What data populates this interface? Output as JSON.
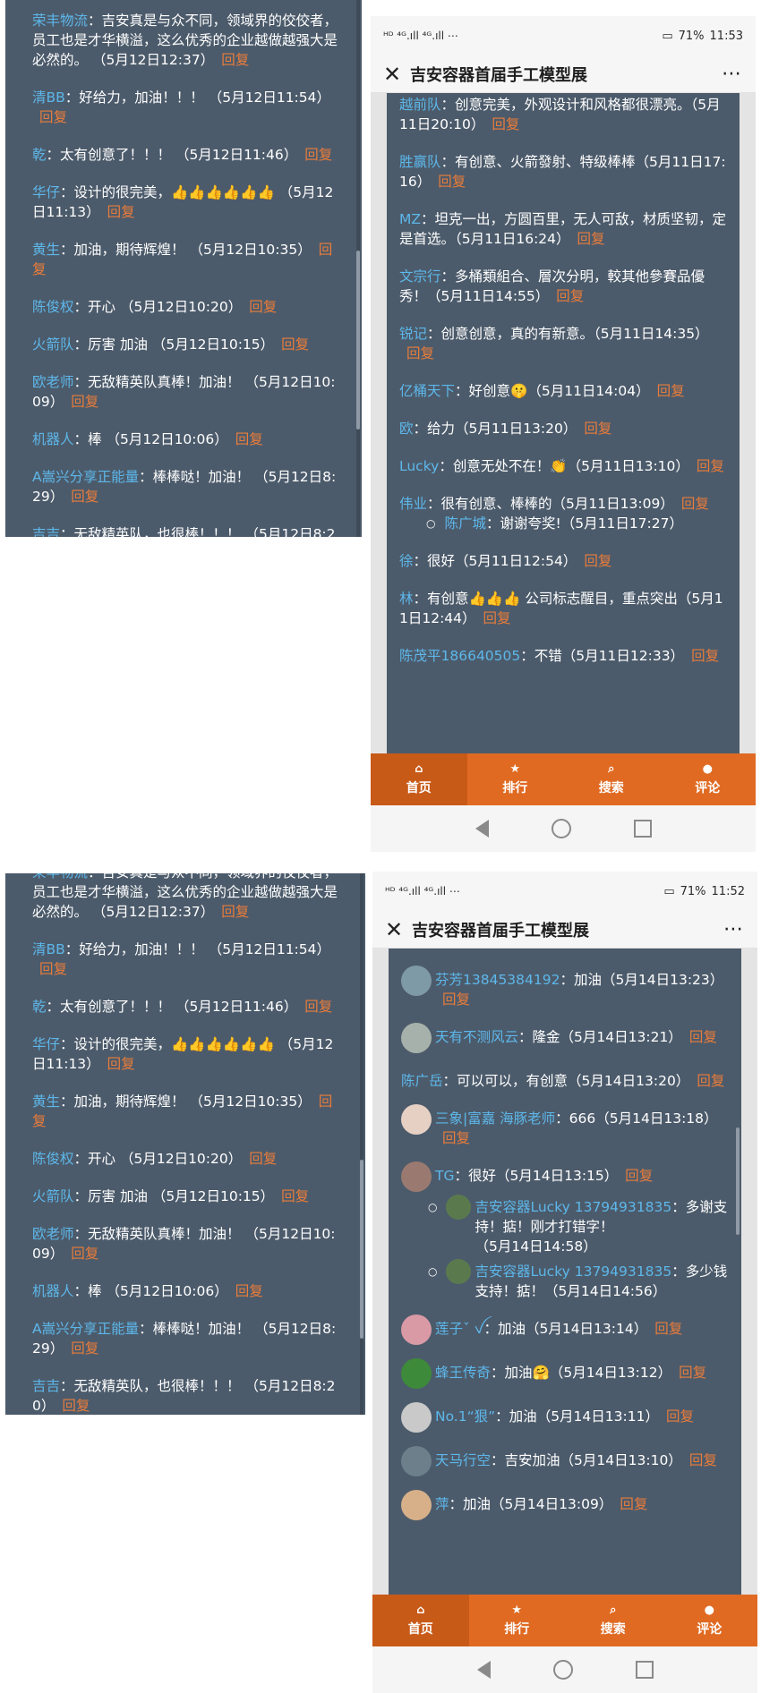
{
  "page": {
    "title": "吉安容器首届手工模型展",
    "reply_label": "回复",
    "colors": {
      "name": "#5db7ea",
      "reply": "#ea7c3a",
      "panel": "#4c5b6b",
      "tabbar": "#e06a22"
    }
  },
  "panel_comments": [
    {
      "name": "荣丰物流",
      "text": "吉安真是与众不同，领域界的佼佼者，员工也是才华横溢，这么优秀的企业越做越强大是必然的。",
      "time": "（5月12日12:37）"
    },
    {
      "name": "清BB",
      "text": "好给力，加油！！！",
      "time": "（5月12日11:54）"
    },
    {
      "name": "乾",
      "text": "太有创意了！！！",
      "time": "（5月12日11:46）"
    },
    {
      "name": "华仔",
      "text": "设计的很完美，👍👍👍👍👍👍",
      "time": "（5月12日11:13）"
    },
    {
      "name": "黄生",
      "text": "加油，期待辉煌！",
      "time": "（5月12日10:35）"
    },
    {
      "name": "陈俊权",
      "text": "开心",
      "time": "（5月12日10:20）"
    },
    {
      "name": "火箭队",
      "text": "厉害 加油",
      "time": "（5月12日10:15）"
    },
    {
      "name": "欧老师",
      "text": "无敌精英队真棒！加油！",
      "time": "（5月12日10:09）"
    },
    {
      "name": "机器人",
      "text": "棒",
      "time": "（5月12日10:06）"
    },
    {
      "name": "A嵩兴分享正能量",
      "text": "棒棒哒！加油！",
      "time": "（5月12日8:29）"
    },
    {
      "name": "吉吉",
      "text": "无敌精英队，也很棒！！！",
      "time": "（5月12日8:20）"
    }
  ],
  "phone1": {
    "status_bar": {
      "indicators": "ᴴᴰ ⁴ᴳ.ıll ⁴ᴳ.ıll ⋯",
      "battery": "71%",
      "time": "11:53"
    },
    "comments": [
      {
        "name": "越前队",
        "text": "创意完美，外观设计和风格都很漂亮。",
        "time": "（5月11日20:10）"
      },
      {
        "name": "胜赢队",
        "text": "有创意、火箭發射、特级棒棒",
        "time": "（5月11日17:16）"
      },
      {
        "name": "MZ",
        "text": "坦克一出，方圆百里，无人可敌，材质坚韧，定是首选。",
        "time": "（5月11日16:24）"
      },
      {
        "name": "文宗行",
        "text": "多桶類組合、層次分明，較其他參賽品優秀！",
        "time": "（5月11日14:55）"
      },
      {
        "name": "锐记",
        "text": "创意创意，真的有新意。",
        "time": "（5月11日14:35）"
      },
      {
        "name": "亿桶天下",
        "text": "好创意🤫",
        "time": "（5月11日14:04）"
      },
      {
        "name": "欧",
        "text": "给力",
        "time": "（5月11日13:20）"
      },
      {
        "name": "Lucky",
        "text": "创意无处不在！👏",
        "time": "（5月11日13:10）"
      },
      {
        "name": "伟业",
        "text": "很有创意、棒棒的",
        "time": "（5月11日13:09）"
      },
      {
        "name": "徐",
        "text": "很好",
        "time": "（5月11日12:54）"
      },
      {
        "name": "林",
        "text": "有创意👍👍👍 公司标志醒目，重点突出",
        "time": "（5月11日12:44）"
      },
      {
        "name": "陈茂平186640505",
        "text": "不错",
        "time": "（5月11日12:33）"
      }
    ],
    "reply_sub": {
      "name": "陈广城",
      "text": "谢谢夸奖!",
      "time": "（5月11日17:27）"
    }
  },
  "phone2": {
    "status_bar": {
      "indicators": "ᴴᴰ ⁴ᴳ.ıll ⁴ᴳ.ıll ⋯",
      "battery": "71%",
      "time": "11:52"
    },
    "comments": [
      {
        "name": "芬芳13845384192",
        "text": "加油",
        "time": "（5月14日13:23）",
        "avatar": "#7d9aa6"
      },
      {
        "name": "天有不测风云",
        "text": "隆金",
        "time": "（5月14日13:21）",
        "avatar": "#a7b1ab"
      },
      {
        "name": "陈广岳",
        "text": "可以可以，有创意",
        "time": "（5月14日13:20）"
      },
      {
        "name": "三象|富嘉 海豚老师",
        "text": "666",
        "time": "（5月14日13:18）",
        "avatar": "#e6d0c4"
      },
      {
        "name": "TG",
        "text": "很好",
        "time": "（5月14日13:15）",
        "avatar": "#9a7a70"
      },
      {
        "name": "莲子ˇ ꪜ",
        "text": "加油",
        "time": "（5月14日13:14）",
        "avatar": "#d99aa6"
      },
      {
        "name": "蜂王传奇",
        "text": "加油🤗",
        "time": "（5月14日13:12）",
        "avatar": "#3d8a3a"
      },
      {
        "name": "No.1“狠”",
        "text": "加油",
        "time": "（5月14日13:11）",
        "avatar": "#c9c9c9"
      },
      {
        "name": "天马行空",
        "text": "吉安加油",
        "time": "（5月14日13:10）",
        "avatar": "#6d7f8a"
      },
      {
        "name": "萍",
        "text": "加油",
        "time": "（5月14日13:09）",
        "avatar": "#d7b08a"
      }
    ],
    "replies": [
      {
        "name": "吉安容器Lucky 13794931835",
        "text": "多谢支持！掂！刚才打错字！",
        "time": "（5月14日14:58）"
      },
      {
        "name": "吉安容器Lucky 13794931835",
        "text": "多少钱支持！掂！",
        "time": "（5月14日14:56）"
      }
    ]
  },
  "tabs": [
    {
      "label": "首页",
      "icon": "⌂"
    },
    {
      "label": "排行",
      "icon": "★"
    },
    {
      "label": "搜索",
      "icon": "⌕"
    },
    {
      "label": "评论",
      "icon": "●"
    }
  ],
  "icons": {
    "close": "close-icon",
    "more": "more-icon",
    "back": "back-icon",
    "home": "home-circle-icon",
    "recent": "recent-square-icon"
  }
}
